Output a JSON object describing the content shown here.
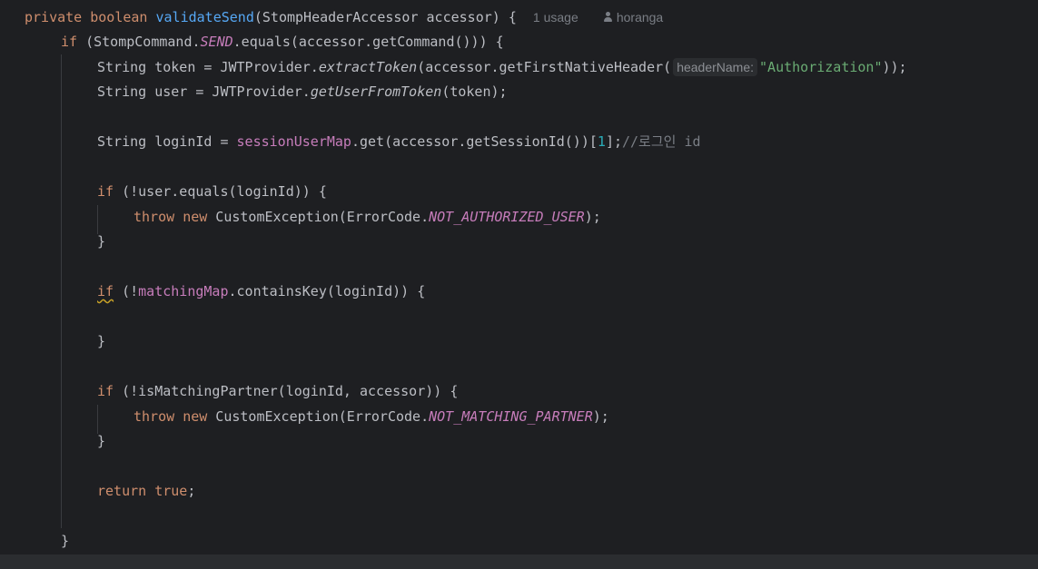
{
  "editor": {
    "signature": {
      "modifier": "private",
      "return_type": "boolean",
      "method_name": "validateSend",
      "params": "(StompHeaderAccessor accessor) {",
      "usages": "1 usage",
      "author": "horanga"
    },
    "if_send": {
      "kw": "if",
      "open": " (StompCommand.",
      "const": "SEND",
      "rest": ".equals(accessor.getCommand())) {"
    },
    "token_line": {
      "pre": "String token = JWTProvider.",
      "method": "extractToken",
      "mid": "(accessor.getFirstNativeHeader(",
      "hint": "headerName:",
      "str": "\"Authorization\"",
      "end": "));"
    },
    "user_line": {
      "pre": "String user = JWTProvider.",
      "method": "getUserFromToken",
      "end": "(token);"
    },
    "login_line": {
      "pre": "String loginId = ",
      "field": "sessionUserMap",
      "mid": ".get(accessor.getSessionId())[",
      "num": "1",
      "end": "];",
      "comment": "//로그인 id"
    },
    "if_user": {
      "kw": "if",
      "rest": " (!user.equals(loginId)) {"
    },
    "throw_auth": {
      "throw": "throw",
      "new": "new",
      "pre": " CustomException(ErrorCode.",
      "const": "NOT_AUTHORIZED_USER",
      "end": ");"
    },
    "close1": "}",
    "if_matching": {
      "kw": "if",
      "open": " (!",
      "field": "matchingMap",
      "rest": ".containsKey(loginId)) {"
    },
    "close2": "}",
    "if_partner": {
      "kw": "if",
      "rest": " (!isMatchingPartner(loginId, accessor)) {"
    },
    "throw_partner": {
      "throw": "throw",
      "new": "new",
      "pre": " CustomException(ErrorCode.",
      "const": "NOT_MATCHING_PARTNER",
      "end": ");"
    },
    "close3": "}",
    "return_line": {
      "kw": "return",
      "val": "true",
      "end": ";"
    },
    "close4": "}"
  }
}
